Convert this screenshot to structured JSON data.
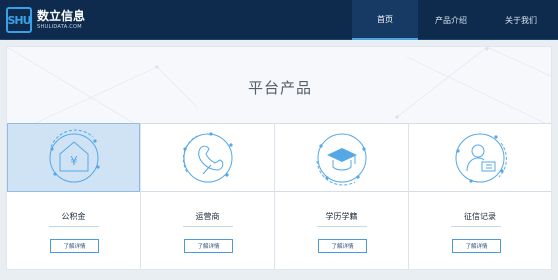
{
  "brand": {
    "mark": "SHU",
    "name": "数立信息",
    "domain": "SHULIDATA.COM"
  },
  "nav": {
    "items": [
      {
        "label": "首页",
        "active": true
      },
      {
        "label": "产品介绍",
        "active": false
      },
      {
        "label": "关于我们",
        "active": false
      }
    ]
  },
  "section": {
    "title": "平台产品"
  },
  "products": [
    {
      "label": "公积金",
      "button": "了解详情",
      "icon": "house-yuan-icon",
      "active": true
    },
    {
      "label": "运营商",
      "button": "了解详情",
      "icon": "phone-handset-icon",
      "active": false
    },
    {
      "label": "学历学籍",
      "button": "了解详情",
      "icon": "graduation-cap-icon",
      "active": false
    },
    {
      "label": "征信记录",
      "button": "了解详情",
      "icon": "user-id-card-icon",
      "active": false
    }
  ],
  "colors": {
    "header_bg": "#0e2b4e",
    "accent": "#4aa3e3",
    "icon_stroke": "#55a8e6",
    "active_card_bg": "#cfe3f5"
  }
}
